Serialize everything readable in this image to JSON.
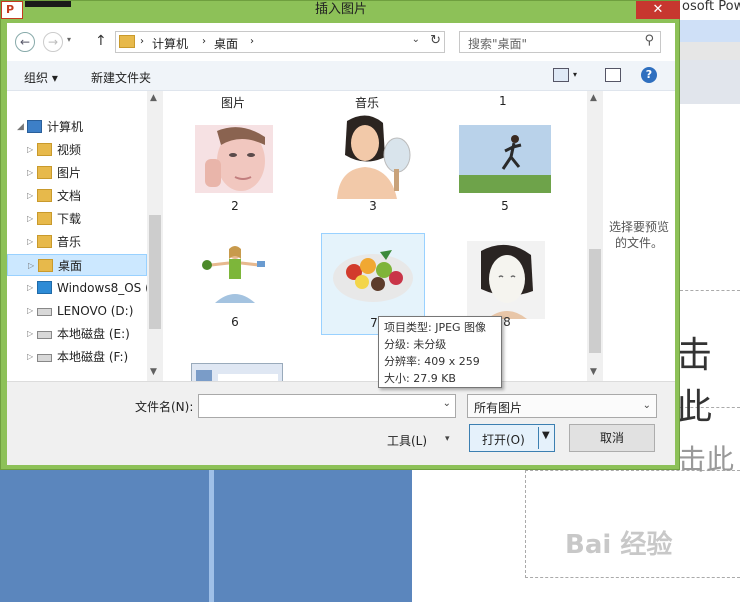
{
  "background": {
    "app_title": "osoft Pow",
    "slide_text_1": "击此",
    "slide_text_2": "击此",
    "watermark": "Bai 经验"
  },
  "dialog": {
    "title": "插入图片",
    "close_label": "✕"
  },
  "address": {
    "segments": [
      "计算机",
      "桌面"
    ],
    "search_placeholder": "搜索\"桌面\""
  },
  "toolbar": {
    "organize": "组织 ▾",
    "new_folder": "新建文件夹"
  },
  "nav": {
    "items": [
      {
        "label": "计算机",
        "icon": "computer-icon"
      },
      {
        "label": "视频",
        "icon": "folder-icon"
      },
      {
        "label": "图片",
        "icon": "folder-icon"
      },
      {
        "label": "文档",
        "icon": "folder-icon"
      },
      {
        "label": "下载",
        "icon": "folder-icon"
      },
      {
        "label": "音乐",
        "icon": "folder-icon"
      },
      {
        "label": "桌面",
        "icon": "folder-icon"
      },
      {
        "label": "Windows8_OS (",
        "icon": "drive-icon"
      },
      {
        "label": "LENOVO (D:)",
        "icon": "drive-icon"
      },
      {
        "label": "本地磁盘 (E:)",
        "icon": "drive-icon"
      },
      {
        "label": "本地磁盘 (F:)",
        "icon": "drive-icon"
      }
    ]
  },
  "files": {
    "top_labels": [
      "图片",
      "音乐",
      "1"
    ],
    "tiles": [
      {
        "label": "2"
      },
      {
        "label": "3"
      },
      {
        "label": "5"
      },
      {
        "label": "6"
      },
      {
        "label": "7"
      },
      {
        "label": "8"
      }
    ]
  },
  "preview": {
    "text": "选择要预览的文件。"
  },
  "tooltip": {
    "type": "项目类型: JPEG 图像",
    "rating": "分级: 未分级",
    "resolution": "分辨率: 409 x 259",
    "size": "大小: 27.9 KB"
  },
  "bottom": {
    "filename_label": "文件名(N):",
    "filename_value": "",
    "filter_value": "所有图片",
    "tools_label": "工具(L)",
    "open_label": "打开(O)",
    "cancel_label": "取消"
  }
}
